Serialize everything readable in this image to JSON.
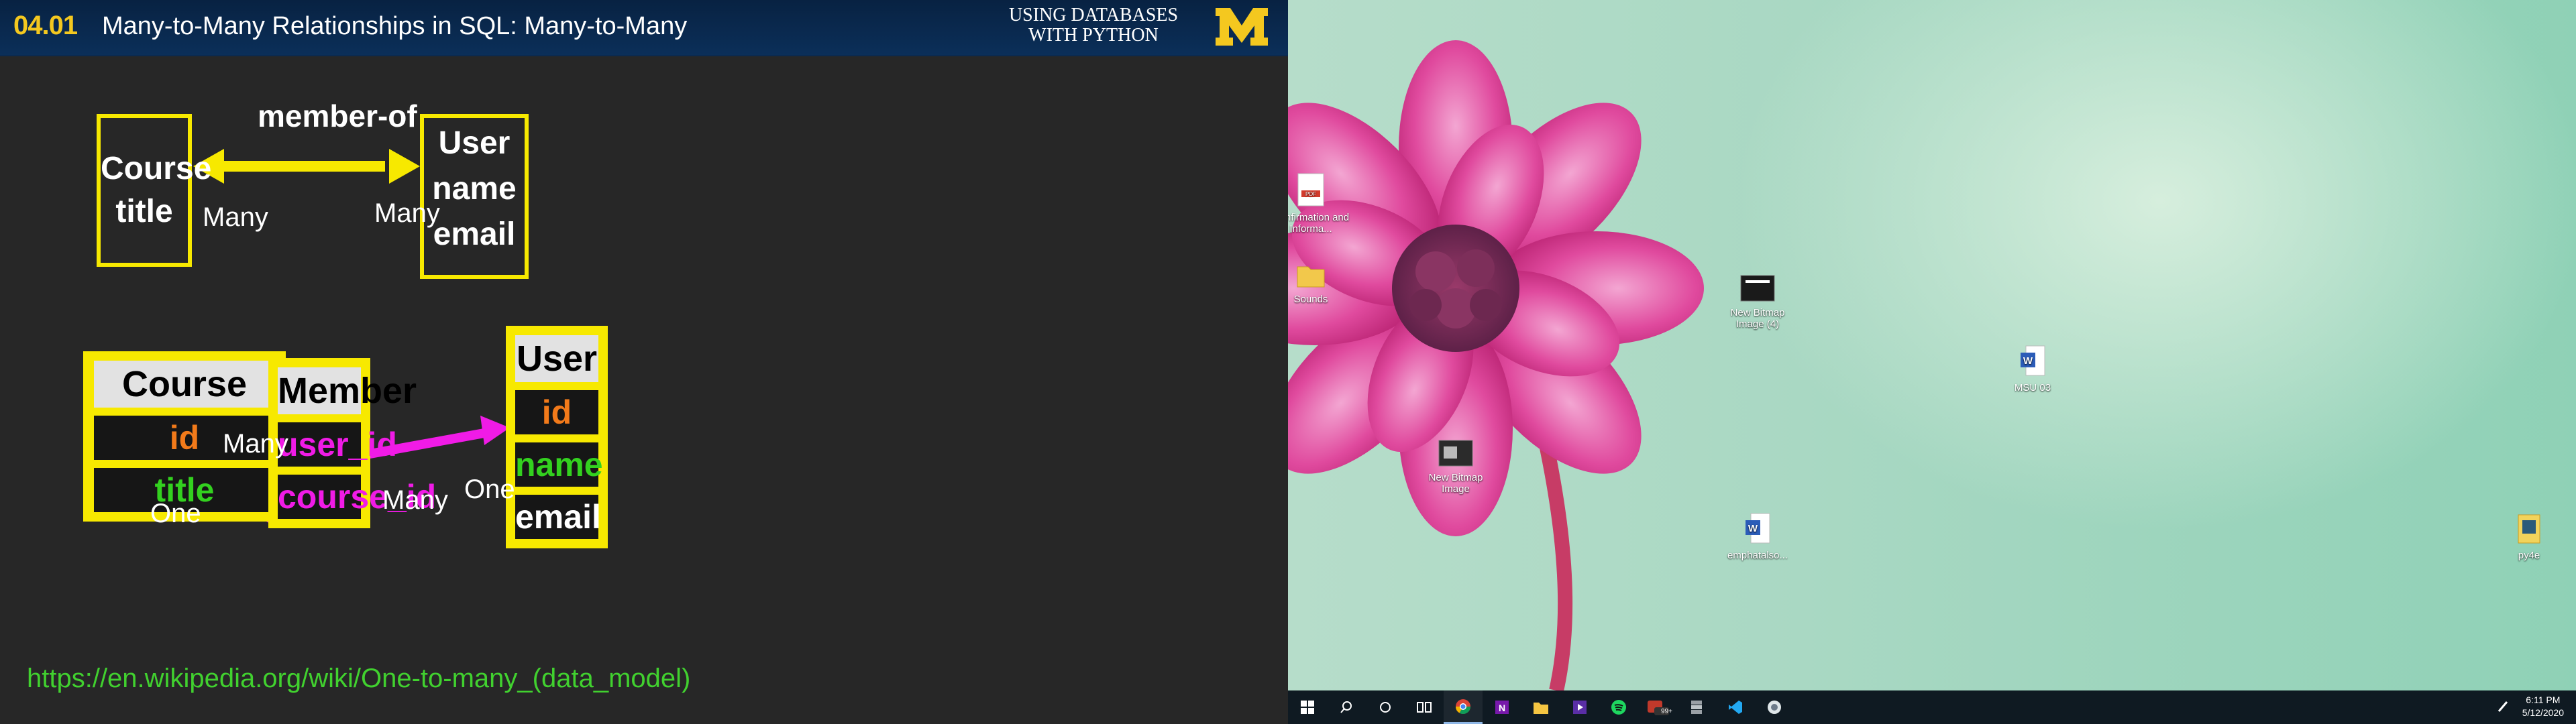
{
  "slide": {
    "number": "04.01",
    "title": "Many-to-Many Relationships in SQL: Many-to-Many",
    "brand_line1": "USING DATABASES",
    "brand_line2": "WITH PYTHON",
    "logo_letter": "M",
    "top_diagram": {
      "relation_label": "member-of",
      "left_box_line1": "Course",
      "left_box_line2": "title",
      "right_box_line1": "User",
      "right_box_line2": "name",
      "right_box_line3": "email",
      "left_cardinality": "Many",
      "right_cardinality": "Many"
    },
    "tables": {
      "course": {
        "name": "Course",
        "fields": [
          "id",
          "title"
        ]
      },
      "member": {
        "name": "Member",
        "fields": [
          "user_id",
          "course_id"
        ]
      },
      "user": {
        "name": "User",
        "fields": [
          "id",
          "name",
          "email"
        ]
      }
    },
    "cardinality_labels": {
      "member_to_course_many": "Many",
      "course_one": "One",
      "member_to_user_many": "Many",
      "user_one": "One"
    },
    "link": "https://en.wikipedia.org/wiki/One-to-many_(data_model)",
    "colors": {
      "yellow": "#f7e900",
      "arrow_magenta": "#f01be6",
      "header_number": "#f4c81f",
      "link_green": "#41d12f"
    }
  },
  "desktop": {
    "icons": [
      {
        "label": "Confirmation and Informa...",
        "icon": "pdf-icon"
      },
      {
        "label": "Sounds",
        "icon": "folder-icon"
      },
      {
        "label": "New Bitmap Image (4)",
        "icon": "bitmap-icon"
      },
      {
        "label": "MSU 03",
        "icon": "word-doc-icon"
      },
      {
        "label": "New Bitmap Image",
        "icon": "bitmap-icon"
      },
      {
        "label": "emphatalso...",
        "icon": "word-doc-icon"
      },
      {
        "label": "py4e",
        "icon": "folder-icon"
      }
    ],
    "taskbar": {
      "apps": [
        "start-icon",
        "search-icon",
        "cortana-icon",
        "task-view-icon",
        "chrome-icon",
        "onenote-icon",
        "file-explorer-icon",
        "media-app-icon",
        "spotify-icon",
        "mail-badge-icon",
        "archive-icon",
        "vscode-icon",
        "misc-app-icon"
      ],
      "mail_badge": "99+",
      "time": "6:11 PM",
      "date": "5/12/2020"
    }
  }
}
